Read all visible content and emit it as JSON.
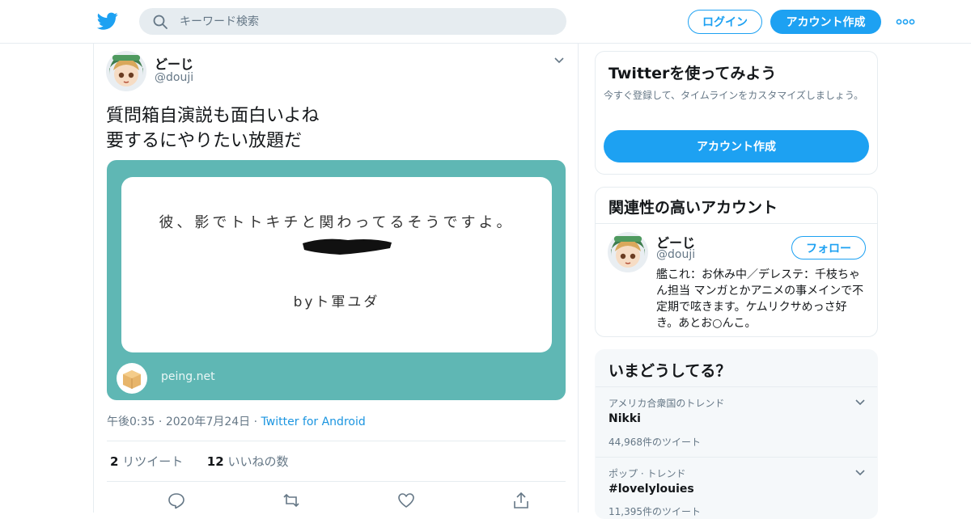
{
  "header": {
    "search_placeholder": "キーワード検索",
    "login_label": "ログイン",
    "signup_label": "アカウント作成"
  },
  "tweet": {
    "author_name": "どーじ",
    "author_handle": "@douji",
    "text_line1": "質問箱自演説も面白いよね",
    "text_line2": "要するにやりたい放題だ",
    "card": {
      "question": "彼、影でトトキチと関わってるそうですよ。",
      "signature": "byト軍ユダ",
      "domain": "peing.net"
    },
    "time": "午後0:35",
    "date": "2020年7月24日",
    "source": "Twitter for Android",
    "retweet_count": "2",
    "retweet_label": "リツイート",
    "like_count": "12",
    "like_label": "いいねの数"
  },
  "signup_card": {
    "title": "Twitterを使ってみよう",
    "subtitle": "今すぐ登録して、タイムラインをカスタマイズしましょう。",
    "button": "アカウント作成"
  },
  "related": {
    "title": "関連性の高いアカウント",
    "name": "どーじ",
    "handle": "@douji",
    "follow_label": "フォロー",
    "bio": "艦これ：お休み中／デレステ：千枝ちゃん担当 マンガとかアニメの事メインで不定期で呟きます。ケムリクサめっさ好き。あとお○んこ。"
  },
  "trends": {
    "title": "いまどうしてる？",
    "items": [
      {
        "context": "アメリカ合衆国のトレンド",
        "name": "Nikki",
        "count": "44,968件のツイート"
      },
      {
        "context": "ポップ · トレンド",
        "name": "#lovelylouies",
        "count": "11,395件のツイート"
      }
    ]
  },
  "colors": {
    "accent": "#1da1f2",
    "card_bg": "#5fb7b4",
    "muted": "#657786",
    "border": "#e6ecf0"
  }
}
